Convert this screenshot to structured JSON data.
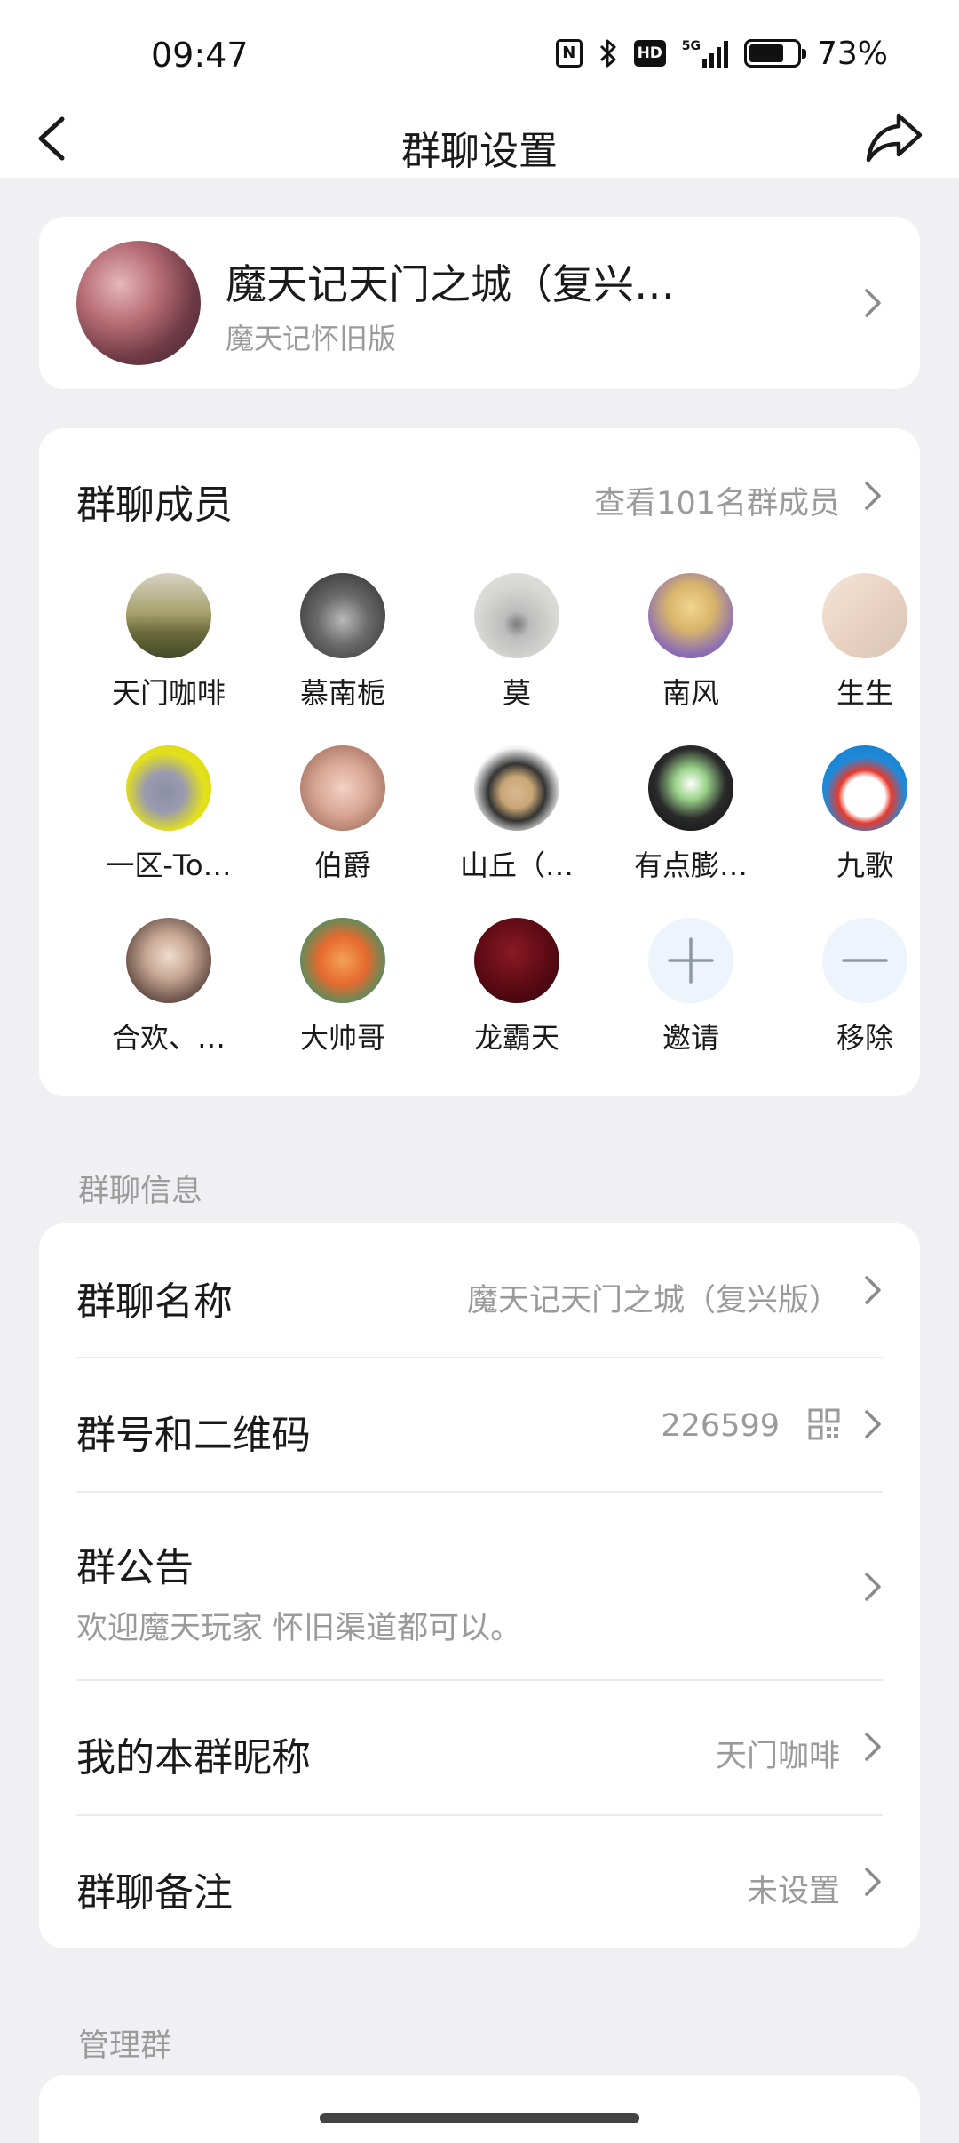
{
  "status": {
    "time": "09:47",
    "battery_percent": "73%",
    "battery_level": 0.73,
    "network": "5G"
  },
  "nav": {
    "title": "群聊设置"
  },
  "group": {
    "name": "魔天记天门之城（复兴…",
    "subtitle": "魔天记怀旧版"
  },
  "members": {
    "title": "群聊成员",
    "view_all": "查看101名群成员",
    "list": [
      {
        "name": "天门咖啡"
      },
      {
        "name": "慕南栀"
      },
      {
        "name": "莫"
      },
      {
        "name": "南风"
      },
      {
        "name": "生生"
      },
      {
        "name": "一区-To…"
      },
      {
        "name": "伯爵"
      },
      {
        "name": "山丘（…"
      },
      {
        "name": "有点膨…"
      },
      {
        "name": "九歌"
      },
      {
        "name": "合欢、…"
      },
      {
        "name": "大帅哥"
      },
      {
        "name": "龙霸天"
      }
    ],
    "invite_label": "邀请",
    "remove_label": "移除"
  },
  "info_section": {
    "label": "群聊信息",
    "group_name": {
      "title": "群聊名称",
      "value": "魔天记天门之城（复兴版）"
    },
    "group_id": {
      "title": "群号和二维码",
      "value": "226599"
    },
    "notice": {
      "title": "群公告",
      "value": "欢迎魔天玩家 怀旧渠道都可以。"
    },
    "my_nickname": {
      "title": "我的本群昵称",
      "value": "天门咖啡"
    },
    "remark": {
      "title": "群聊备注",
      "value": "未设置"
    }
  },
  "manage_section": {
    "label": "管理群"
  }
}
